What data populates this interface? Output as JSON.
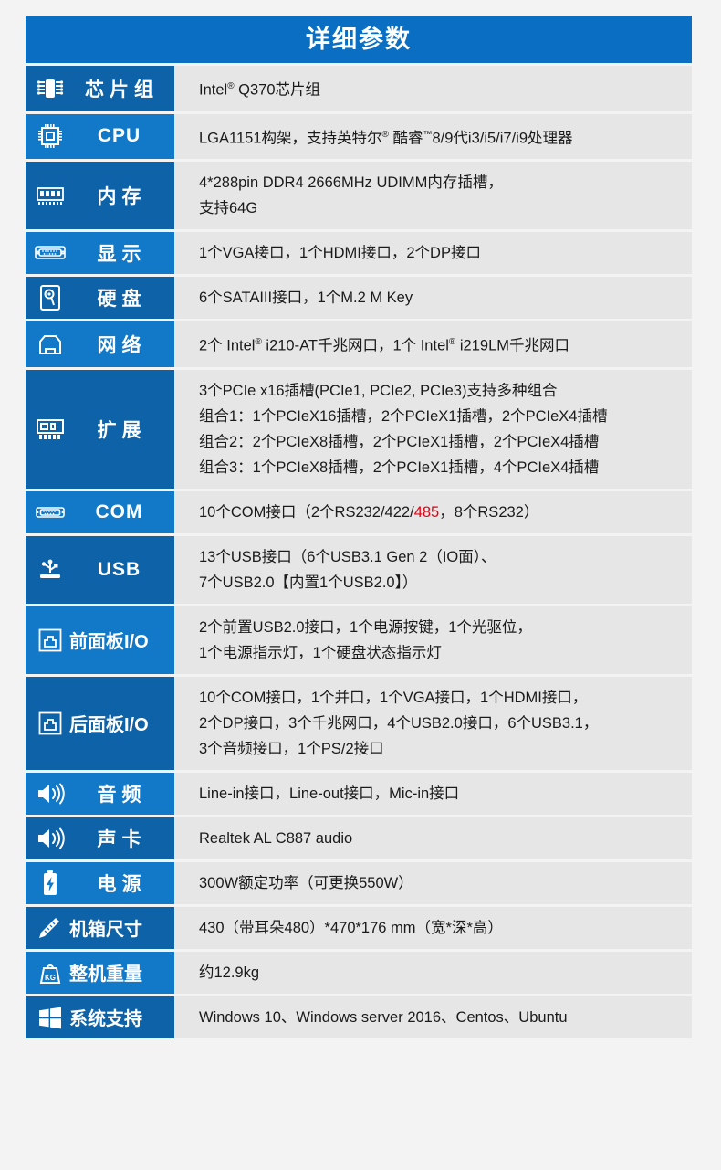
{
  "header": {
    "title": "详细参数"
  },
  "colors": {
    "header_blue": "#0a6fc2",
    "label_blue_dark": "#0d62a8",
    "label_blue_light": "#1279c8",
    "value_grey": "#e6e6e6",
    "highlight_red": "#e60012"
  },
  "rows": [
    {
      "icon": "chipset-icon",
      "label": "芯片组",
      "lines": [
        "Intel® Q370芯片组"
      ]
    },
    {
      "icon": "cpu-icon",
      "label": "CPU",
      "lines": [
        "LGA1151构架，支持英特尔® 酷睿™8/9代i3/i5/i7/i9处理器"
      ]
    },
    {
      "icon": "memory-icon",
      "label": "内存",
      "lines": [
        "4*288pin DDR4 2666MHz UDIMM内存插槽，",
        "支持64G"
      ]
    },
    {
      "icon": "display-icon",
      "label": "显示",
      "lines": [
        "1个VGA接口，1个HDMI接口，2个DP接口"
      ]
    },
    {
      "icon": "harddisk-icon",
      "label": "硬盘",
      "lines": [
        "6个SATAIII接口，1个M.2 M Key"
      ]
    },
    {
      "icon": "network-icon",
      "label": "网络",
      "lines": [
        "2个 Intel® i210-AT千兆网口，1个 Intel® i219LM千兆网口"
      ]
    },
    {
      "icon": "expansion-icon",
      "label": "扩展",
      "lines": [
        "3个PCIe x16插槽(PCIe1, PCIe2, PCIe3)支持多种组合",
        "组合1：1个PCIeX16插槽，2个PCIeX1插槽，2个PCIeX4插槽",
        "组合2：2个PCIeX8插槽，2个PCIeX1插槽，2个PCIeX4插槽",
        "组合3：1个PCIeX8插槽，2个PCIeX1插槽，4个PCIeX4插槽"
      ]
    },
    {
      "icon": "com-port-icon",
      "label": "COM",
      "lines": [
        "10个COM接口（2个RS232/422/485，8个RS232）"
      ],
      "highlight": "485"
    },
    {
      "icon": "usb-icon",
      "label": "USB",
      "lines": [
        "13个USB接口（6个USB3.1 Gen 2（IO面）、",
        "7个USB2.0【内置1个USB2.0】）"
      ]
    },
    {
      "icon": "front-panel-icon",
      "label": "前面板I/O",
      "lines": [
        "2个前置USB2.0接口，1个电源按键，1个光驱位，",
        "1个电源指示灯，1个硬盘状态指示灯"
      ]
    },
    {
      "icon": "rear-panel-icon",
      "label": "后面板I/O",
      "lines": [
        "10个COM接口，1个并口，1个VGA接口，1个HDMI接口，",
        "2个DP接口，3个千兆网口，4个USB2.0接口，6个USB3.1，",
        "3个音频接口，1个PS/2接口"
      ]
    },
    {
      "icon": "audio-icon",
      "label": "音频",
      "lines": [
        "Line-in接口，Line-out接口，Mic-in接口"
      ]
    },
    {
      "icon": "soundcard-icon",
      "label": "声卡",
      "lines": [
        "Realtek AL C887 audio"
      ]
    },
    {
      "icon": "power-icon",
      "label": "电源",
      "lines": [
        "300W额定功率（可更换550W）"
      ]
    },
    {
      "icon": "dimensions-icon",
      "label": "机箱尺寸",
      "lines": [
        "430（带耳朵480）*470*176 mm（宽*深*高）"
      ]
    },
    {
      "icon": "weight-icon",
      "label": "整机重量",
      "lines": [
        "约12.9kg"
      ]
    },
    {
      "icon": "windows-icon",
      "label": "系统支持",
      "lines": [
        "Windows 10、Windows server 2016、Centos、Ubuntu"
      ]
    }
  ]
}
